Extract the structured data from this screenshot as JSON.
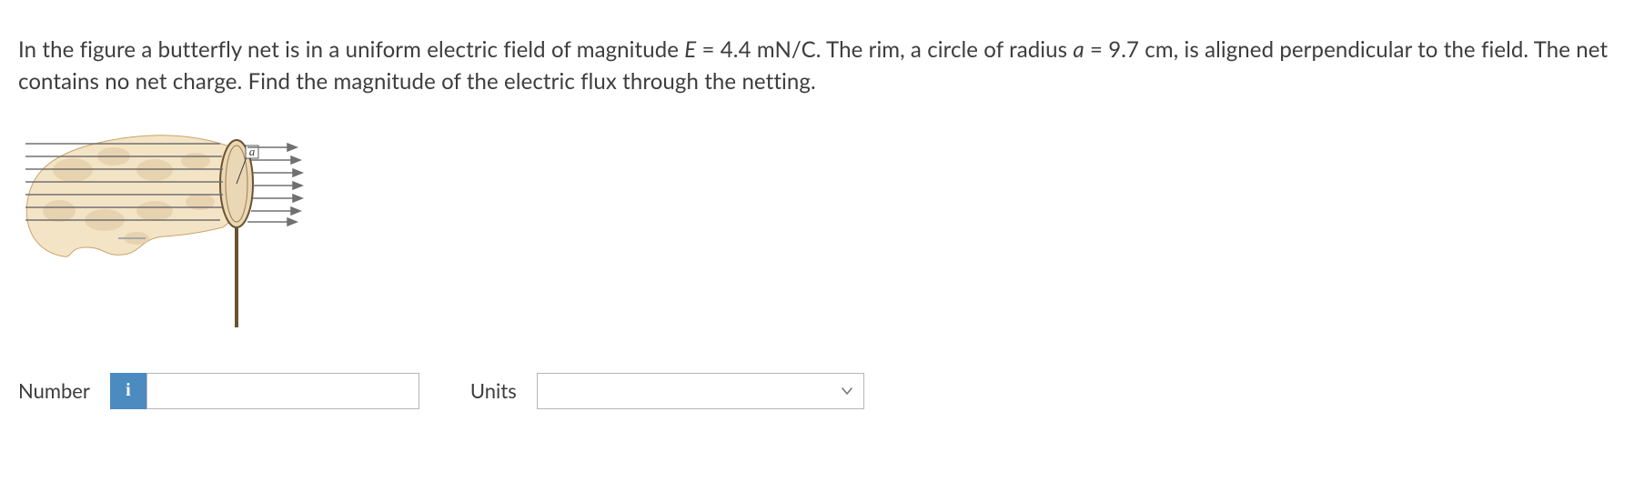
{
  "problem": {
    "pre": "In the figure a butterfly net is in a uniform electric field of magnitude ",
    "E_sym": "E",
    "E_eq": " = 4.4 mN/C. The rim, a circle of radius ",
    "a_sym": "a",
    "a_eq": " = 9.7 cm, is aligned perpendicular to the field. The net contains no net charge. Find the magnitude of the electric flux through the netting."
  },
  "figure": {
    "radius_label": "a"
  },
  "answer": {
    "number_label": "Number",
    "info_badge": "i",
    "number_value": "",
    "number_placeholder": "",
    "units_label": "Units",
    "units_selected": "",
    "units_options": []
  }
}
